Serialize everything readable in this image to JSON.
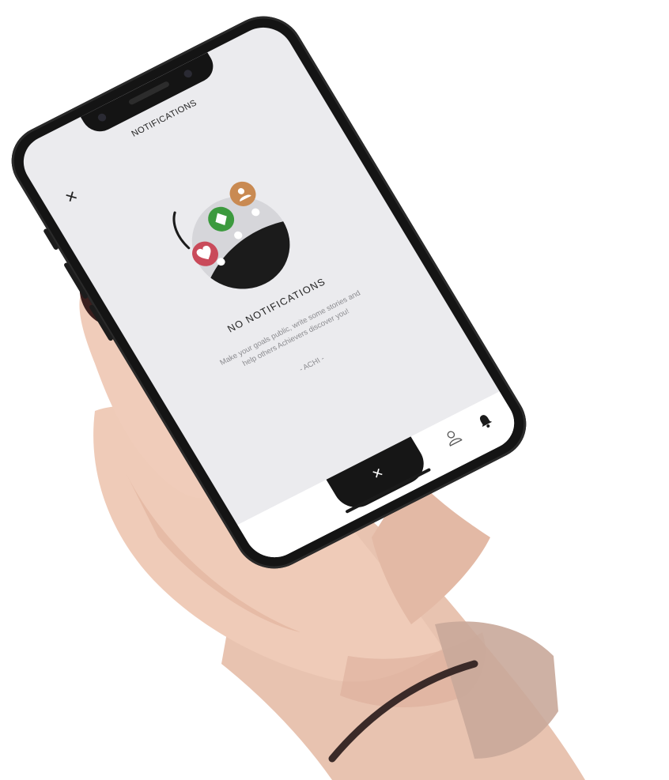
{
  "screen": {
    "title": "NOTIFICATIONS",
    "close_icon": "close-icon"
  },
  "empty_state": {
    "title": "NO NOTIFICATIONS",
    "message": "Make your goals public, write some stories and help others Achievers discover you!",
    "signature": "- ACHI -",
    "illustration_icons": [
      "heart-icon",
      "diamond-icon",
      "person-icon"
    ]
  },
  "tab_bar": {
    "active_tab_icon": "close-icon",
    "tabs": [
      "profile-icon",
      "bell-icon"
    ]
  },
  "colors": {
    "screen_background": "#ebebee",
    "heart_bubble": "#c94a5a",
    "diamond_bubble": "#3c9a3e",
    "person_bubble": "#c98a52",
    "dark": "#161616",
    "muted_text": "#8b8b8f"
  }
}
